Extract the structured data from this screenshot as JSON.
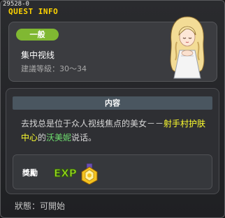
{
  "window": {
    "quest_id": "29528-0",
    "title": "QUEST INFO"
  },
  "quest": {
    "badge": "一般",
    "name": "集中视线",
    "level": "建議等級：30～34",
    "npc_icon": "blonde-lady-npc-portrait"
  },
  "content": {
    "header": "内容",
    "text_1": "去找总是位于众人视线焦点的美女－－",
    "highlight_1": "射手村护肤中心",
    "text_2": "的",
    "highlight_2": "沃美妮",
    "text_3": "说话。"
  },
  "reward": {
    "label": "獎勵",
    "exp_icon": "exp-icon",
    "item_icon": "gold-medal-item-icon"
  },
  "status": "狀態：可開始",
  "colors": {
    "title": "#ffd400",
    "badge": "#80b832",
    "highlight_location": "#ffff2e",
    "highlight_npc": "#6fe06f"
  }
}
